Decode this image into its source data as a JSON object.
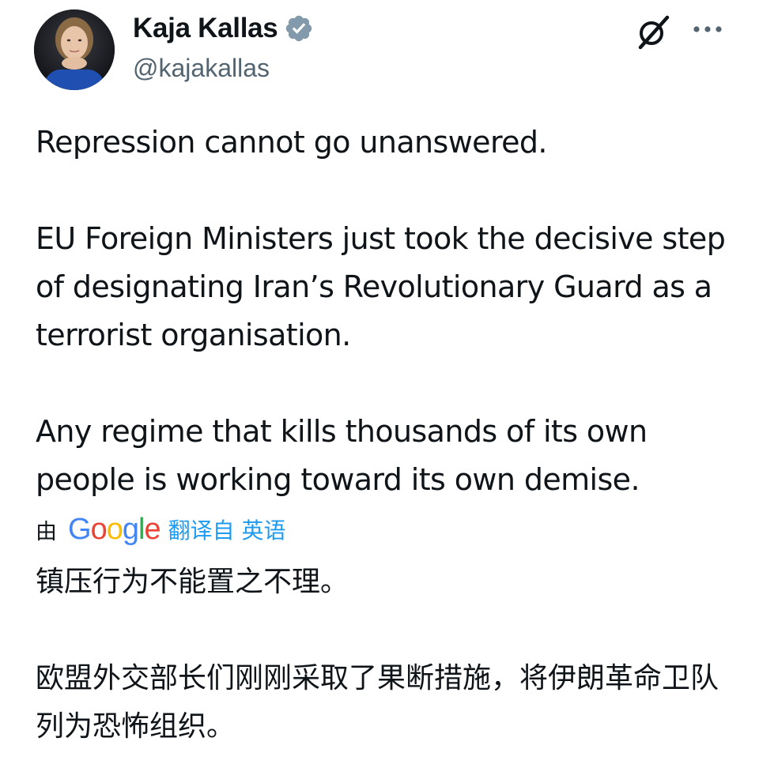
{
  "author": {
    "display_name": "Kaja Kallas",
    "handle": "@kajakallas",
    "verified_icon": "verified-badge-icon",
    "avatar": "profile-photo"
  },
  "header_actions": {
    "grok_icon": "grok-icon",
    "more_icon": "more-options-icon"
  },
  "tweet": {
    "paragraphs": [
      "Repression cannot go unanswered.",
      "EU Foreign Ministers just took the decisive step of designating Iran’s Revolutionary Guard as a terrorist organisation.",
      "Any regime that kills thousands of its own people is working toward its own demise."
    ]
  },
  "translation": {
    "prefix": "由",
    "provider_letters": [
      "G",
      "o",
      "o",
      "g",
      "l",
      "e"
    ],
    "provider_colors": [
      "#4285f4",
      "#ea4335",
      "#fbbc05",
      "#4285f4",
      "#34a853",
      "#ea4335"
    ],
    "translated_from": "翻译自 英语",
    "paragraphs": [
      "镇压行为不能置之不理。",
      "欧盟外交部长们刚刚采取了果断措施，将伊朗革命卫队列为恐怖组织。"
    ]
  },
  "colors": {
    "text_primary": "#0f1419",
    "text_secondary": "#536471",
    "link_blue": "#1d9bf0",
    "verified_gray": "#829aab"
  }
}
